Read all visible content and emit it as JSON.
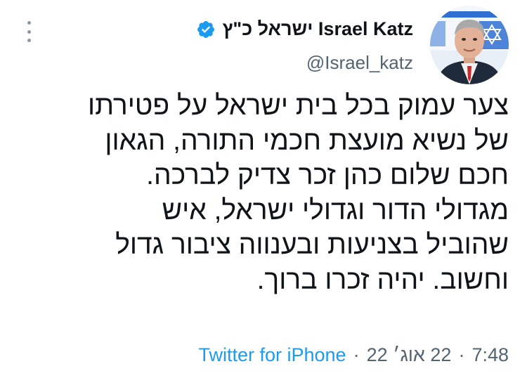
{
  "author": {
    "display_name": "ישראל כ\"ץ Israel Katz",
    "handle": "@Israel_katz",
    "verified": true,
    "verified_color": "#1d9bf0"
  },
  "tweet": {
    "lines": [
      "צער עמוק בכל בית ישראל על פטירתו",
      "של נשיא מועצת חכמי התורה, הגאון",
      "חכם שלום כהן זכר צדיק לברכה.",
      "מגדולי הדור וגדולי ישראל, איש",
      "שהוביל בצניעות ובענווה ציבור גדול",
      "וחשוב. יהיה זכרו ברוך."
    ]
  },
  "meta": {
    "time": "7:48",
    "separator": "·",
    "date": "22 אוג׳ 22",
    "source": "Twitter for iPhone"
  },
  "icons": {
    "more": "more-dots-icon",
    "verified": "verified-badge-icon"
  },
  "colors": {
    "text": "#0f1419",
    "secondary": "#536471",
    "link": "#1d9bf0"
  }
}
